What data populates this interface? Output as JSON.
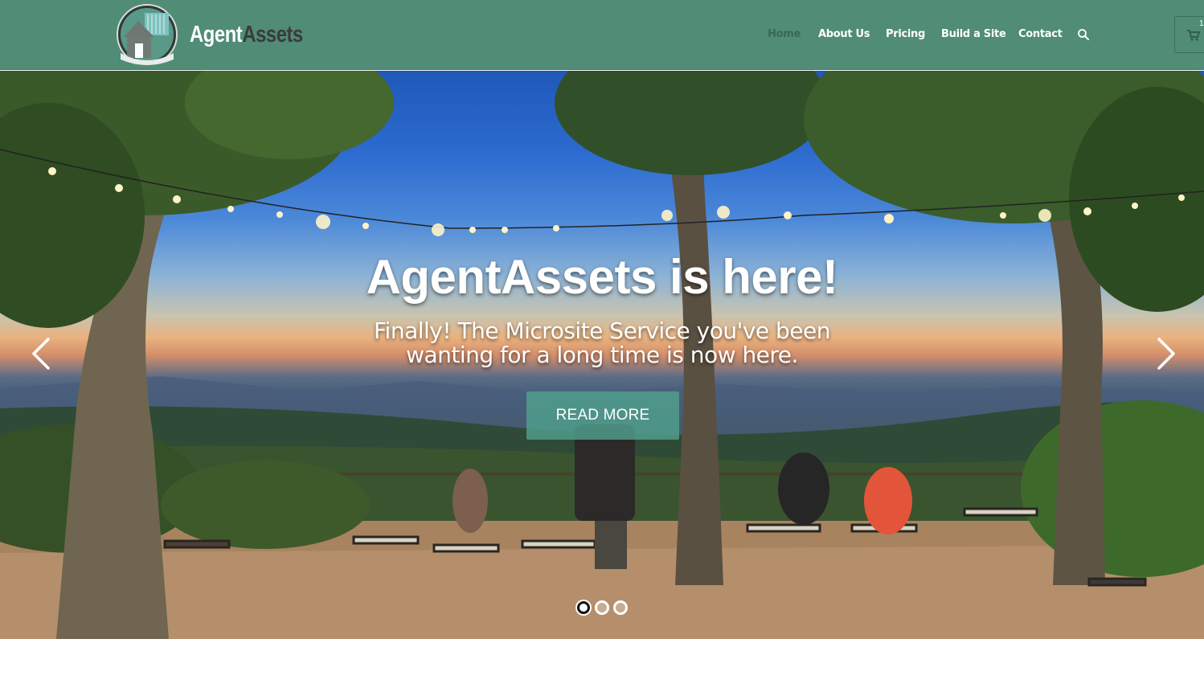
{
  "brand": {
    "name_part1": "Agent",
    "name_part2": "Assets"
  },
  "nav": {
    "items": [
      {
        "label": "Home",
        "active": true
      },
      {
        "label": "About Us"
      },
      {
        "label": "Pricing"
      },
      {
        "label": "Build a Site"
      },
      {
        "label": "Contact"
      }
    ],
    "search_icon": "search-icon",
    "cart_icon": "cart-icon",
    "cart_count": "1"
  },
  "hero": {
    "title": "AgentAssets is here!",
    "subtitle_line1": "Finally! The Microsite Service you've been",
    "subtitle_line2": "wanting for a long time is now here.",
    "cta_label": "READ MORE",
    "slide_count": 3,
    "active_slide": 1
  },
  "colors": {
    "header_bg": "#508c76",
    "cta_bg": "#50a08c"
  }
}
